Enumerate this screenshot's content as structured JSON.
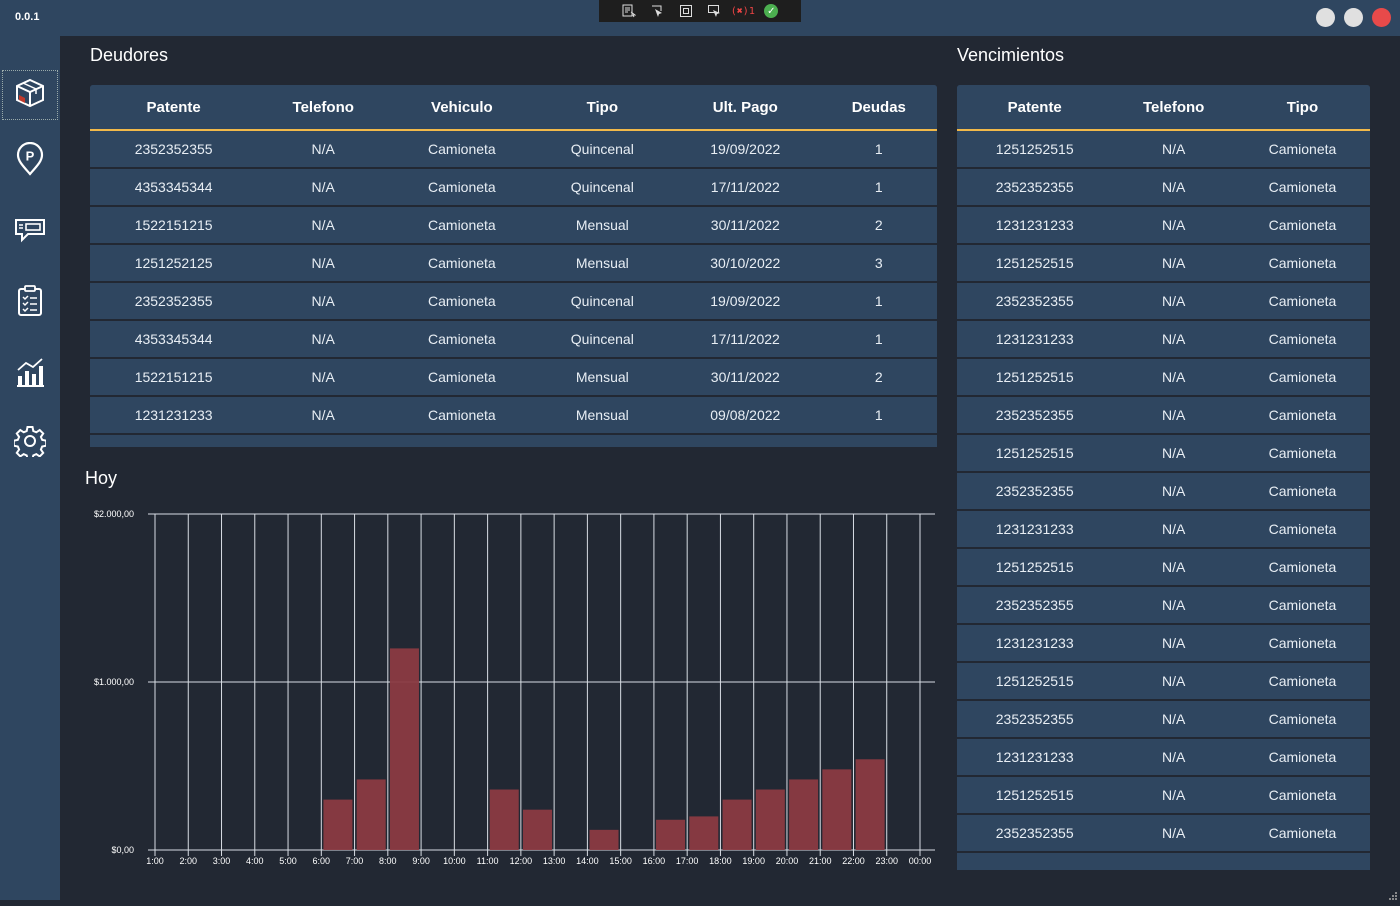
{
  "app": {
    "version": "0.0.1"
  },
  "devtools": {
    "error_count": "1"
  },
  "colors": {
    "titlebar": "#2f4660",
    "background": "#222833",
    "accent": "#f1b94a",
    "bar": "#8b3a42",
    "close": "#e84a4a"
  },
  "sidebar": {
    "items": [
      {
        "icon": "box-icon"
      },
      {
        "icon": "parking-icon"
      },
      {
        "icon": "ticket-icon"
      },
      {
        "icon": "checklist-icon"
      },
      {
        "icon": "chart-icon"
      },
      {
        "icon": "settings-icon"
      }
    ]
  },
  "deudores": {
    "title": "Deudores",
    "columns": [
      "Patente",
      "Telefono",
      "Vehiculo",
      "Tipo",
      "Ult. Pago",
      "Deudas"
    ],
    "rows": [
      [
        "2352352355",
        "N/A",
        "Camioneta",
        "Quincenal",
        "19/09/2022",
        "1"
      ],
      [
        "4353345344",
        "N/A",
        "Camioneta",
        "Quincenal",
        "17/11/2022",
        "1"
      ],
      [
        "1522151215",
        "N/A",
        "Camioneta",
        "Mensual",
        "30/11/2022",
        "2"
      ],
      [
        "1251252125",
        "N/A",
        "Camioneta",
        "Mensual",
        "30/10/2022",
        "3"
      ],
      [
        "2352352355",
        "N/A",
        "Camioneta",
        "Quincenal",
        "19/09/2022",
        "1"
      ],
      [
        "4353345344",
        "N/A",
        "Camioneta",
        "Quincenal",
        "17/11/2022",
        "1"
      ],
      [
        "1522151215",
        "N/A",
        "Camioneta",
        "Mensual",
        "30/11/2022",
        "2"
      ],
      [
        "1231231233",
        "N/A",
        "Camioneta",
        "Mensual",
        "09/08/2022",
        "1"
      ]
    ]
  },
  "vencimientos": {
    "title": "Vencimientos",
    "columns": [
      "Patente",
      "Telefono",
      "Tipo"
    ],
    "rows": [
      [
        "1251252515",
        "N/A",
        "Camioneta"
      ],
      [
        "2352352355",
        "N/A",
        "Camioneta"
      ],
      [
        "1231231233",
        "N/A",
        "Camioneta"
      ],
      [
        "1251252515",
        "N/A",
        "Camioneta"
      ],
      [
        "2352352355",
        "N/A",
        "Camioneta"
      ],
      [
        "1231231233",
        "N/A",
        "Camioneta"
      ],
      [
        "1251252515",
        "N/A",
        "Camioneta"
      ],
      [
        "2352352355",
        "N/A",
        "Camioneta"
      ],
      [
        "1251252515",
        "N/A",
        "Camioneta"
      ],
      [
        "2352352355",
        "N/A",
        "Camioneta"
      ],
      [
        "1231231233",
        "N/A",
        "Camioneta"
      ],
      [
        "1251252515",
        "N/A",
        "Camioneta"
      ],
      [
        "2352352355",
        "N/A",
        "Camioneta"
      ],
      [
        "1231231233",
        "N/A",
        "Camioneta"
      ],
      [
        "1251252515",
        "N/A",
        "Camioneta"
      ],
      [
        "2352352355",
        "N/A",
        "Camioneta"
      ],
      [
        "1231231233",
        "N/A",
        "Camioneta"
      ],
      [
        "1251252515",
        "N/A",
        "Camioneta"
      ],
      [
        "2352352355",
        "N/A",
        "Camioneta"
      ]
    ]
  },
  "chart_title": "Hoy",
  "chart_data": {
    "type": "bar",
    "title": "",
    "xlabel": "",
    "ylabel": "",
    "categories": [
      "1:00",
      "2:00",
      "3:00",
      "4:00",
      "5:00",
      "6:00",
      "7:00",
      "8:00",
      "9:00",
      "10:00",
      "11:00",
      "12:00",
      "13:00",
      "14:00",
      "15:00",
      "16:00",
      "17:00",
      "18:00",
      "19:00",
      "20:00",
      "21:00",
      "22:00",
      "23:00",
      "00:00"
    ],
    "values": [
      0,
      0,
      0,
      0,
      0,
      300,
      420,
      1200,
      0,
      0,
      360,
      240,
      0,
      120,
      0,
      180,
      200,
      300,
      360,
      420,
      480,
      540,
      0,
      0
    ],
    "ylim": [
      0,
      2000
    ],
    "yticks": [
      0,
      1000,
      2000
    ],
    "ytick_labels": [
      "$0,00",
      "$1.000,00",
      "$2.000,00"
    ],
    "grid": true
  }
}
